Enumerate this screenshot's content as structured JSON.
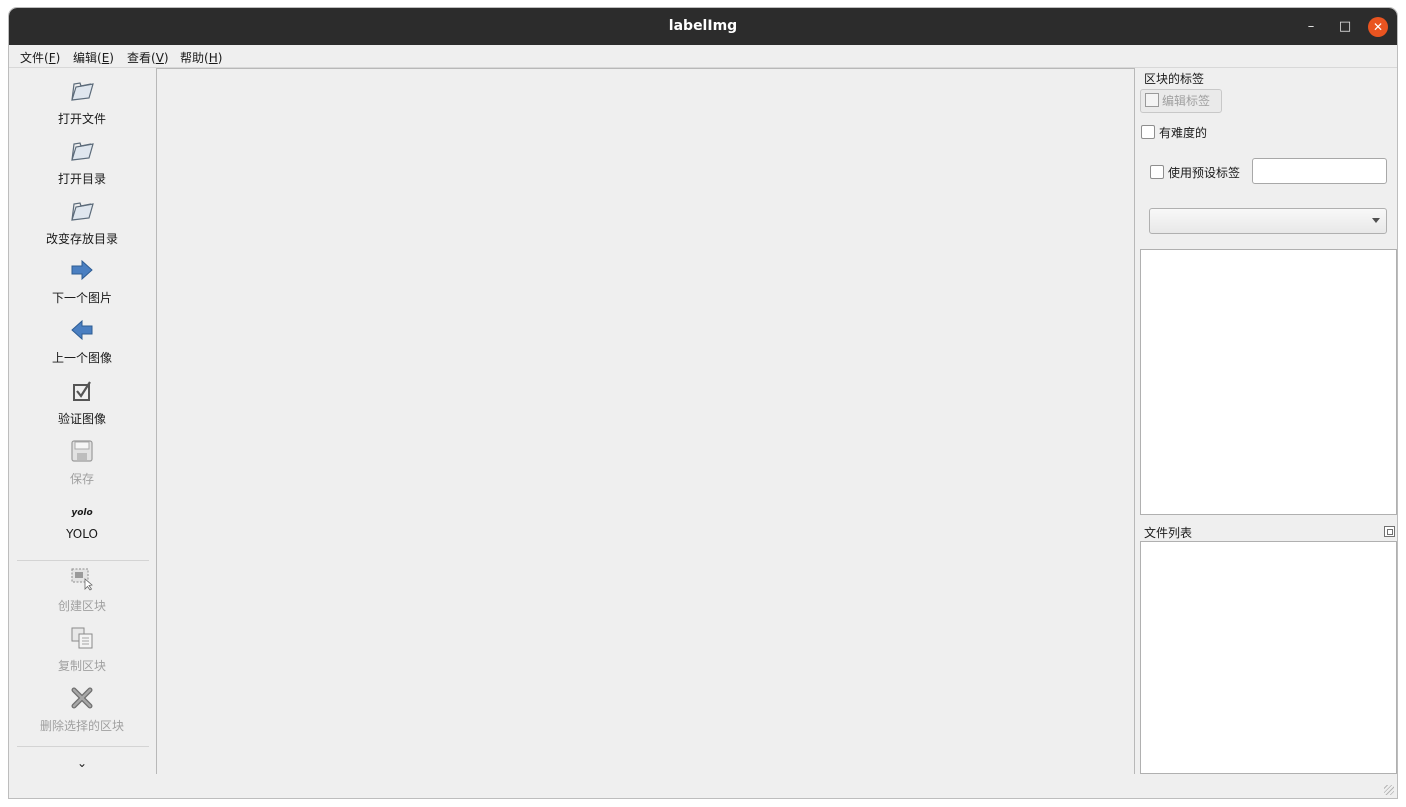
{
  "window": {
    "title": "labelImg"
  },
  "titlebar_buttons": {
    "minimize": "–",
    "maximize": "□",
    "close": "✕"
  },
  "menubar": [
    {
      "label": "文件(",
      "key": "F",
      "end": ")"
    },
    {
      "label": "编辑(",
      "key": "E",
      "end": ")"
    },
    {
      "label": "查看(",
      "key": "V",
      "end": ")"
    },
    {
      "label": "帮助(",
      "key": "H",
      "end": ")"
    }
  ],
  "toolbar": {
    "open_file": "打开文件",
    "open_dir": "打开目录",
    "change_save_dir": "改变存放目录",
    "next_image": "下一个图片",
    "prev_image": "上一个图像",
    "verify_image": "验证图像",
    "save": "保存",
    "format_icon_text": "yolo",
    "format": "YOLO",
    "create_box": "创建区块",
    "duplicate_box": "复制区块",
    "delete_box": "删除选择的区块",
    "more": "⌄"
  },
  "box_labels_panel": {
    "title": "区块的标签",
    "edit_label_button": "编辑标签",
    "difficult_checkbox": "有难度的",
    "use_default_label_checkbox": "使用预设标签",
    "default_label_value": "",
    "label_combo_value": ""
  },
  "file_list_panel": {
    "title": "文件列表"
  },
  "colors": {
    "titlebar": "#2c2c2c",
    "close_button": "#e95420",
    "window_bg": "#efefef"
  }
}
